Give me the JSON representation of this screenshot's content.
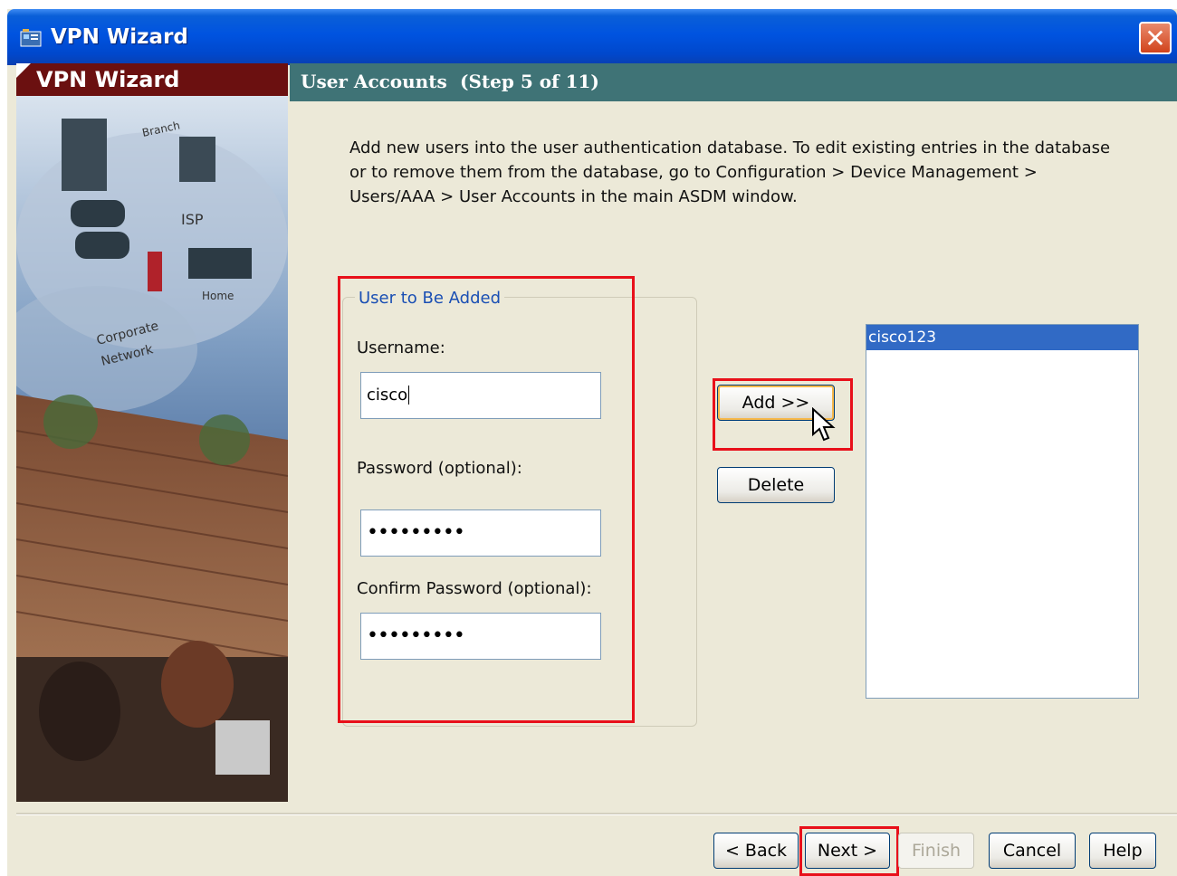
{
  "window": {
    "title": "VPN Wizard",
    "close_glyph": "✕"
  },
  "sidebar": {
    "banner": "VPN Wizard",
    "illustration": "network-illustration"
  },
  "header": {
    "title": "User Accounts",
    "step": "(Step 5 of 11)"
  },
  "intro": {
    "line1": "Add new users into the user authentication database. To edit existing entries in the database",
    "line2": "or to remove them from the database, go to Configuration > Device Management >",
    "line3": "Users/AAA > User Accounts in the main ASDM window."
  },
  "form": {
    "group_title": "User to Be Added",
    "username_label": "Username:",
    "username_value": "cisco",
    "password_label": "Password (optional):",
    "password_value": "•••••••••",
    "confirm_label": "Confirm Password (optional):",
    "confirm_value": "•••••••••"
  },
  "actions": {
    "add": "Add >>",
    "delete": "Delete"
  },
  "user_list": {
    "items": [
      "cisco123"
    ]
  },
  "footer": {
    "back": "< Back",
    "next": "Next >",
    "finish": "Finish",
    "cancel": "Cancel",
    "help": "Help"
  },
  "colors": {
    "titlebar": "#0053e0",
    "header": "#3f7376",
    "banner": "#6b1010",
    "highlight": "#e8101a",
    "selection": "#316ac5"
  }
}
